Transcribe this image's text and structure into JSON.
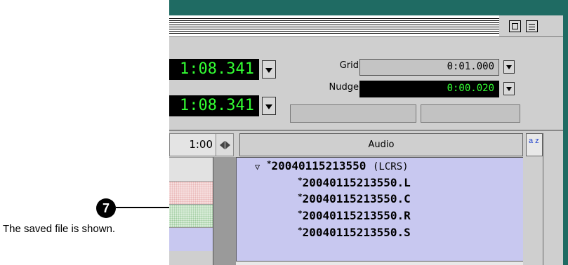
{
  "counters": {
    "main": "1:08.341",
    "sub": "1:08.341"
  },
  "grid": {
    "label": "Grid",
    "value": "0:01.000"
  },
  "nudge": {
    "label": "Nudge",
    "value": "0:00.020"
  },
  "timeline": {
    "ruler_label": "1:00"
  },
  "regions": {
    "header": "Audio",
    "sort_glyph": "a z",
    "parent": {
      "marker": "*",
      "name": "20040115213550",
      "tag": "(LCRS)"
    },
    "children": [
      {
        "marker": "*",
        "name": "20040115213550.L"
      },
      {
        "marker": "*",
        "name": "20040115213550.C"
      },
      {
        "marker": "*",
        "name": "20040115213550.R"
      },
      {
        "marker": "*",
        "name": "20040115213550.S"
      }
    ]
  },
  "callout": {
    "number": "7",
    "caption": "The saved file is shown."
  },
  "colors": {
    "counter_digits": "#33ff33",
    "region_list_bg": "#c8c8f0",
    "window_border": "#1f6b63"
  }
}
